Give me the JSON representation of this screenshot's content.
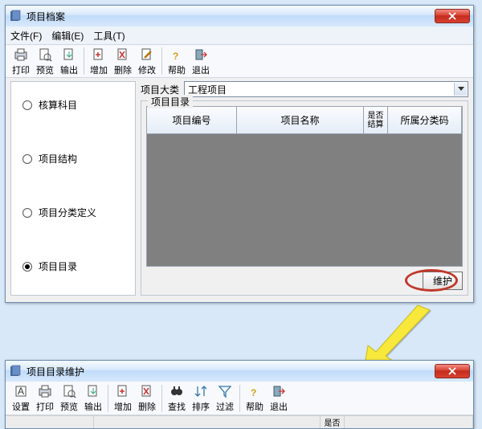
{
  "window1": {
    "title": "项目档案",
    "menu": {
      "file": "文件(F)",
      "edit": "编辑(E)",
      "tool": "工具(T)"
    },
    "toolbar": {
      "print": "打印",
      "preview": "预览",
      "export": "输出",
      "add": "增加",
      "delete": "删除",
      "modify": "修改",
      "help": "帮助",
      "exit": "退出"
    },
    "sidebar": {
      "items": [
        {
          "label": "核算科目",
          "selected": false
        },
        {
          "label": "项目结构",
          "selected": false
        },
        {
          "label": "项目分类定义",
          "selected": false
        },
        {
          "label": "项目目录",
          "selected": true
        }
      ]
    },
    "category": {
      "label": "项目大类",
      "value": "工程项目"
    },
    "group_label": "项目目录",
    "table": {
      "headers": [
        "项目编号",
        "项目名称",
        "是否结算",
        "所属分类码"
      ]
    },
    "maintain_btn": "维护"
  },
  "window2": {
    "title": "项目目录维护",
    "toolbar": {
      "setup": "设置",
      "print": "打印",
      "preview": "预览",
      "export": "输出",
      "add": "增加",
      "delete": "删除",
      "find": "查找",
      "sort": "排序",
      "filter": "过滤",
      "help": "帮助",
      "exit": "退出"
    },
    "strip_label": "是否"
  }
}
